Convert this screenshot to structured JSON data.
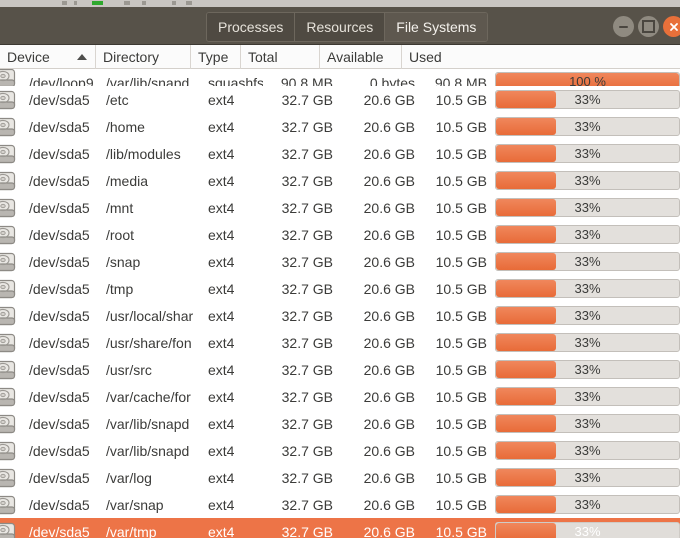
{
  "window": {
    "tabs": [
      {
        "label": "Processes",
        "active": false
      },
      {
        "label": "Resources",
        "active": false
      },
      {
        "label": "File Systems",
        "active": true
      }
    ],
    "controls": {
      "minimize": "minimize-button",
      "maximize": "maximize-button",
      "close": "close-button"
    }
  },
  "colors": {
    "accent_orange": "#ed7447",
    "titlebar": "#575249",
    "selection": "#ed7447",
    "progress_track": "#e3e0dc"
  },
  "table": {
    "columns": [
      {
        "label": "Device",
        "sort": "asc"
      },
      {
        "label": "Directory",
        "sort": ""
      },
      {
        "label": "Type",
        "sort": ""
      },
      {
        "label": "Total",
        "sort": ""
      },
      {
        "label": "Available",
        "sort": ""
      },
      {
        "label": "Used",
        "sort": ""
      }
    ],
    "rows": [
      {
        "icon": "disk-icon",
        "device": "/dev/loop9",
        "directory": "/var/lib/snapd",
        "type": "squashfs",
        "total": "90.8 MB",
        "available": "0 bytes",
        "used": "90.8 MB",
        "percent_label": "100 %",
        "percent": 100,
        "clipped": true,
        "selected": false
      },
      {
        "icon": "disk-icon",
        "device": "/dev/sda5",
        "directory": "/etc",
        "type": "ext4",
        "total": "32.7 GB",
        "available": "20.6 GB",
        "used": "10.5 GB",
        "percent_label": "33%",
        "percent": 33,
        "clipped": false,
        "selected": false
      },
      {
        "icon": "disk-icon",
        "device": "/dev/sda5",
        "directory": "/home",
        "type": "ext4",
        "total": "32.7 GB",
        "available": "20.6 GB",
        "used": "10.5 GB",
        "percent_label": "33%",
        "percent": 33,
        "clipped": false,
        "selected": false
      },
      {
        "icon": "disk-icon",
        "device": "/dev/sda5",
        "directory": "/lib/modules",
        "type": "ext4",
        "total": "32.7 GB",
        "available": "20.6 GB",
        "used": "10.5 GB",
        "percent_label": "33%",
        "percent": 33,
        "clipped": false,
        "selected": false
      },
      {
        "icon": "disk-icon",
        "device": "/dev/sda5",
        "directory": "/media",
        "type": "ext4",
        "total": "32.7 GB",
        "available": "20.6 GB",
        "used": "10.5 GB",
        "percent_label": "33%",
        "percent": 33,
        "clipped": false,
        "selected": false
      },
      {
        "icon": "disk-icon",
        "device": "/dev/sda5",
        "directory": "/mnt",
        "type": "ext4",
        "total": "32.7 GB",
        "available": "20.6 GB",
        "used": "10.5 GB",
        "percent_label": "33%",
        "percent": 33,
        "clipped": false,
        "selected": false
      },
      {
        "icon": "disk-icon",
        "device": "/dev/sda5",
        "directory": "/root",
        "type": "ext4",
        "total": "32.7 GB",
        "available": "20.6 GB",
        "used": "10.5 GB",
        "percent_label": "33%",
        "percent": 33,
        "clipped": false,
        "selected": false
      },
      {
        "icon": "disk-icon",
        "device": "/dev/sda5",
        "directory": "/snap",
        "type": "ext4",
        "total": "32.7 GB",
        "available": "20.6 GB",
        "used": "10.5 GB",
        "percent_label": "33%",
        "percent": 33,
        "clipped": false,
        "selected": false
      },
      {
        "icon": "disk-icon",
        "device": "/dev/sda5",
        "directory": "/tmp",
        "type": "ext4",
        "total": "32.7 GB",
        "available": "20.6 GB",
        "used": "10.5 GB",
        "percent_label": "33%",
        "percent": 33,
        "clipped": false,
        "selected": false
      },
      {
        "icon": "disk-icon",
        "device": "/dev/sda5",
        "directory": "/usr/local/shar",
        "type": "ext4",
        "total": "32.7 GB",
        "available": "20.6 GB",
        "used": "10.5 GB",
        "percent_label": "33%",
        "percent": 33,
        "clipped": false,
        "selected": false
      },
      {
        "icon": "disk-icon",
        "device": "/dev/sda5",
        "directory": "/usr/share/fon",
        "type": "ext4",
        "total": "32.7 GB",
        "available": "20.6 GB",
        "used": "10.5 GB",
        "percent_label": "33%",
        "percent": 33,
        "clipped": false,
        "selected": false
      },
      {
        "icon": "disk-icon",
        "device": "/dev/sda5",
        "directory": "/usr/src",
        "type": "ext4",
        "total": "32.7 GB",
        "available": "20.6 GB",
        "used": "10.5 GB",
        "percent_label": "33%",
        "percent": 33,
        "clipped": false,
        "selected": false
      },
      {
        "icon": "disk-icon",
        "device": "/dev/sda5",
        "directory": "/var/cache/for",
        "type": "ext4",
        "total": "32.7 GB",
        "available": "20.6 GB",
        "used": "10.5 GB",
        "percent_label": "33%",
        "percent": 33,
        "clipped": false,
        "selected": false
      },
      {
        "icon": "disk-icon",
        "device": "/dev/sda5",
        "directory": "/var/lib/snapd",
        "type": "ext4",
        "total": "32.7 GB",
        "available": "20.6 GB",
        "used": "10.5 GB",
        "percent_label": "33%",
        "percent": 33,
        "clipped": false,
        "selected": false
      },
      {
        "icon": "disk-icon",
        "device": "/dev/sda5",
        "directory": "/var/lib/snapd",
        "type": "ext4",
        "total": "32.7 GB",
        "available": "20.6 GB",
        "used": "10.5 GB",
        "percent_label": "33%",
        "percent": 33,
        "clipped": false,
        "selected": false
      },
      {
        "icon": "disk-icon",
        "device": "/dev/sda5",
        "directory": "/var/log",
        "type": "ext4",
        "total": "32.7 GB",
        "available": "20.6 GB",
        "used": "10.5 GB",
        "percent_label": "33%",
        "percent": 33,
        "clipped": false,
        "selected": false
      },
      {
        "icon": "disk-icon",
        "device": "/dev/sda5",
        "directory": "/var/snap",
        "type": "ext4",
        "total": "32.7 GB",
        "available": "20.6 GB",
        "used": "10.5 GB",
        "percent_label": "33%",
        "percent": 33,
        "clipped": false,
        "selected": false
      },
      {
        "icon": "disk-icon",
        "device": "/dev/sda5",
        "directory": "/var/tmp",
        "type": "ext4",
        "total": "32.7 GB",
        "available": "20.6 GB",
        "used": "10.5 GB",
        "percent_label": "33%",
        "percent": 33,
        "clipped": false,
        "selected": true
      }
    ]
  }
}
